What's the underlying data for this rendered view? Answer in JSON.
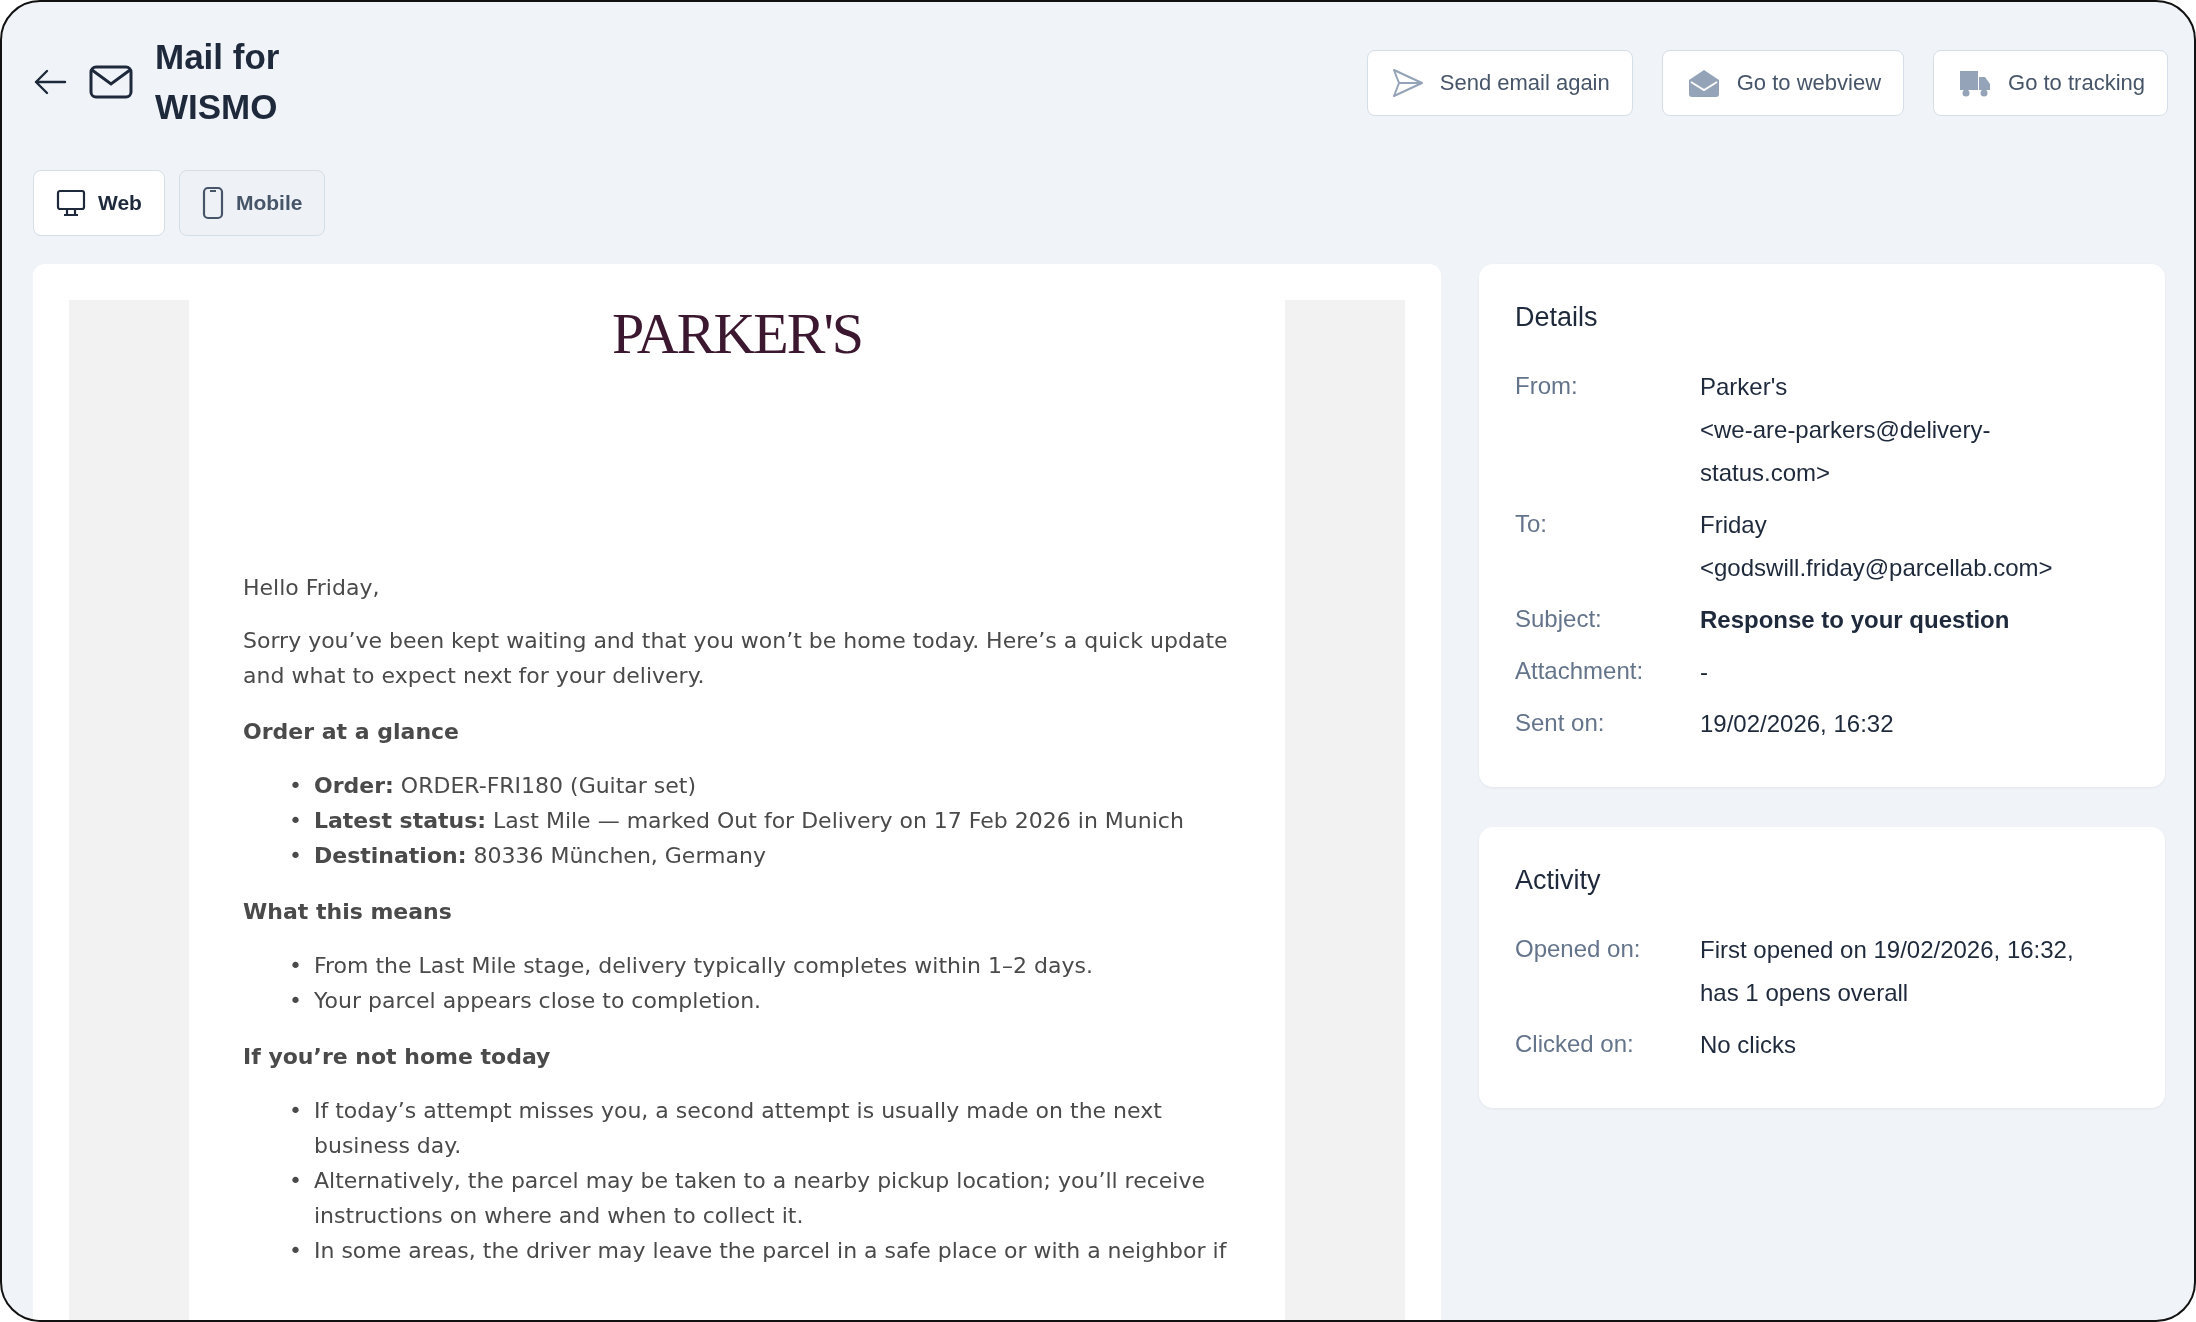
{
  "header": {
    "title": "Mail for WISMO"
  },
  "actions": [
    {
      "kind": "send",
      "label": "Send email again"
    },
    {
      "kind": "webview",
      "label": "Go to webview"
    },
    {
      "kind": "tracking",
      "label": "Go to tracking"
    }
  ],
  "tabs": [
    {
      "kind": "web",
      "label": "Web",
      "selected": true
    },
    {
      "kind": "mobile",
      "label": "Mobile",
      "selected": false
    }
  ],
  "email": {
    "logo": "PARKER'S",
    "bullet_marker": "•",
    "greeting": "Hello Friday,",
    "intro": "Sorry you’ve been kept waiting and that you won’t be home today. Here’s a quick update and what to expect next for your delivery.",
    "sections": [
      {
        "heading": "Order at a glance",
        "bullets": [
          "**Order:** ORDER-FRI180 (Guitar set)",
          "**Latest status:** Last Mile — marked Out for Delivery on 17 Feb 2026 in Munich",
          "**Destination:** 80336 München, Germany"
        ]
      },
      {
        "heading": "What this means",
        "bullets": [
          "From the Last Mile stage, delivery typically completes within 1–2 days.",
          "Your parcel appears close to completion."
        ]
      },
      {
        "heading": "If you’re not home today",
        "bullets": [
          "If today’s attempt misses you, a second attempt is usually made on the next business day.",
          "Alternatively, the parcel may be taken to a nearby pickup location; you’ll receive instructions on where and when to collect it.",
          "In some areas, the driver may leave the parcel in a safe place or with a neighbor if"
        ]
      }
    ]
  },
  "details": {
    "title": "Details",
    "rows": [
      {
        "label": "From:",
        "lines": [
          "Parker's",
          "<we-are-parkers@delivery-status.com>"
        ],
        "bold": false
      },
      {
        "label": "To:",
        "lines": [
          "Friday",
          "<godswill.friday@parcellab.com>"
        ],
        "bold": false
      },
      {
        "label": "Subject:",
        "lines": [
          "Response to your question"
        ],
        "bold": true
      },
      {
        "label": "Attachment:",
        "lines": [
          "-"
        ],
        "bold": false
      },
      {
        "label": "Sent on:",
        "lines": [
          "19/02/2026, 16:32"
        ],
        "bold": false
      }
    ]
  },
  "activity": {
    "title": "Activity",
    "rows": [
      {
        "label": "Opened on:",
        "lines": [
          "First opened on 19/02/2026, 16:32, has 1 opens overall"
        ],
        "bold": false
      },
      {
        "label": "Clicked on:",
        "lines": [
          "No clicks"
        ],
        "bold": false
      }
    ]
  }
}
